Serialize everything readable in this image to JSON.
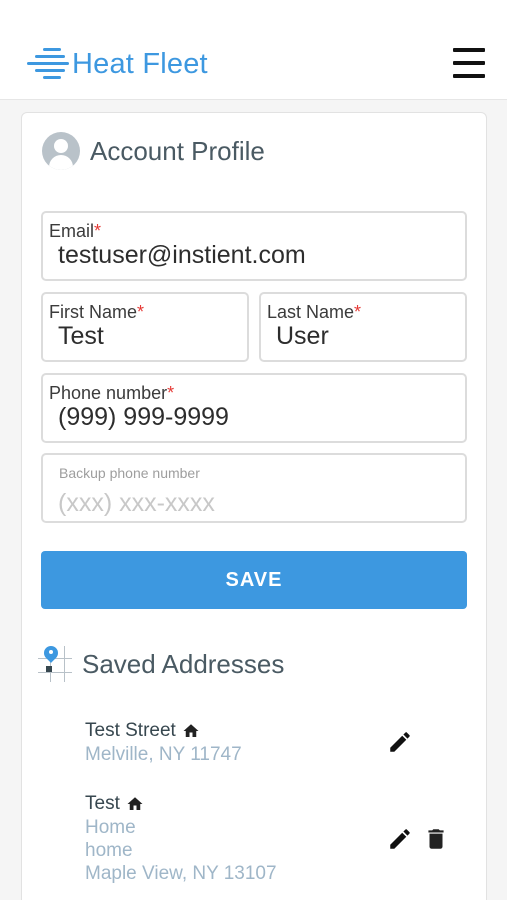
{
  "header": {
    "brand_name": "Heat Fleet",
    "menu_icon": "hamburger-menu-icon",
    "brand_color": "#3d98e0"
  },
  "profile": {
    "title": "Account Profile",
    "icon": "user-avatar-icon",
    "email": {
      "label": "Email",
      "required_mark": "*",
      "value": "testuser@instient.com"
    },
    "first_name": {
      "label": "First Name",
      "required_mark": "*",
      "value": "Test"
    },
    "last_name": {
      "label": "Last Name",
      "required_mark": "*",
      "value": "User"
    },
    "phone": {
      "label": "Phone number",
      "required_mark": "*",
      "value": "(999) 999-9999"
    },
    "backup_phone": {
      "label": "Backup phone number",
      "placeholder": "(xxx) xxx-xxxx",
      "value": ""
    },
    "save_label": "SAVE"
  },
  "addresses": {
    "title": "Saved Addresses",
    "icon": "map-pin-icon",
    "items": [
      {
        "name": "Test Street",
        "lines": [
          "Melville, NY 11747"
        ],
        "home_icon": "home-icon",
        "actions": [
          "edit-icon"
        ]
      },
      {
        "name": "Test",
        "lines": [
          "Home",
          "home",
          "Maple View, NY 13107"
        ],
        "home_icon": "home-icon",
        "actions": [
          "edit-icon",
          "trash-icon"
        ]
      }
    ]
  },
  "colors": {
    "accent": "#3d98e0",
    "required": "#e53935",
    "muted_text": "#9fb6c8"
  }
}
